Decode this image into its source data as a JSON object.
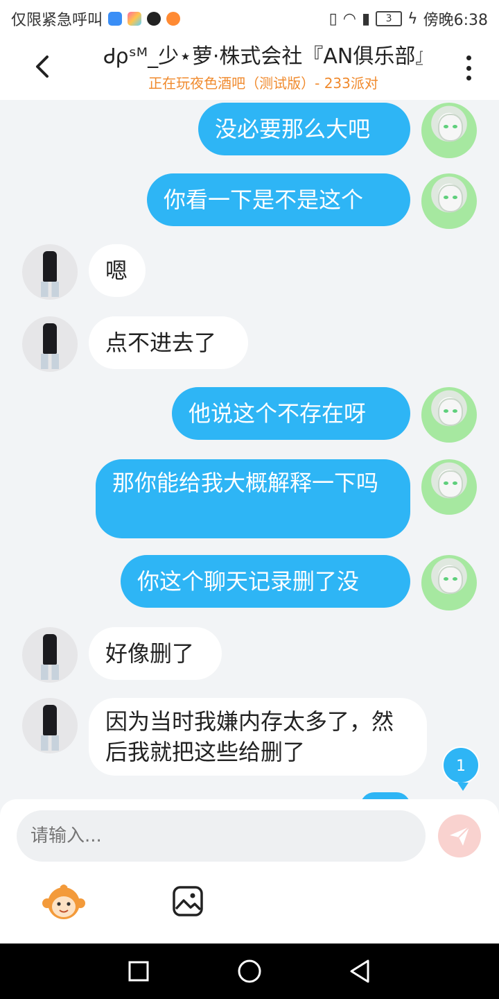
{
  "status_bar": {
    "carrier_text": "仅限紧急呼叫",
    "battery": "3",
    "time": "傍晚6:38",
    "app_icons": [
      "shield-app-icon",
      "colorful-app-icon",
      "tiktok-icon",
      "orange-app-icon"
    ]
  },
  "header": {
    "title": "Ꮷρˢᴹ_少⋆萝·株式会社『AN俱乐部』.",
    "subtitle": "正在玩夜色酒吧（测试版）- 233派对"
  },
  "messages": [
    {
      "from": "me",
      "text": "没必要那么大吧"
    },
    {
      "from": "me",
      "text": "你看一下是不是这个"
    },
    {
      "from": "other",
      "text": "嗯"
    },
    {
      "from": "other",
      "text": "点不进去了"
    },
    {
      "from": "me",
      "text": "他说这个不存在呀"
    },
    {
      "from": "me",
      "text": "那你能给我大概解释一下吗"
    },
    {
      "from": "me",
      "text": "你这个聊天记录删了没"
    },
    {
      "from": "other",
      "text": "好像删了"
    },
    {
      "from": "other",
      "text": "因为当时我嫌内存太多了，然后我就把这些给删了"
    }
  ],
  "unread_badge": "1",
  "composer": {
    "placeholder": "请输入..."
  },
  "colors": {
    "my_bubble": "#2eb5f5",
    "other_bubble": "#ffffff",
    "subtitle": "#f08a2d",
    "send_button": "#f9d2cf"
  }
}
